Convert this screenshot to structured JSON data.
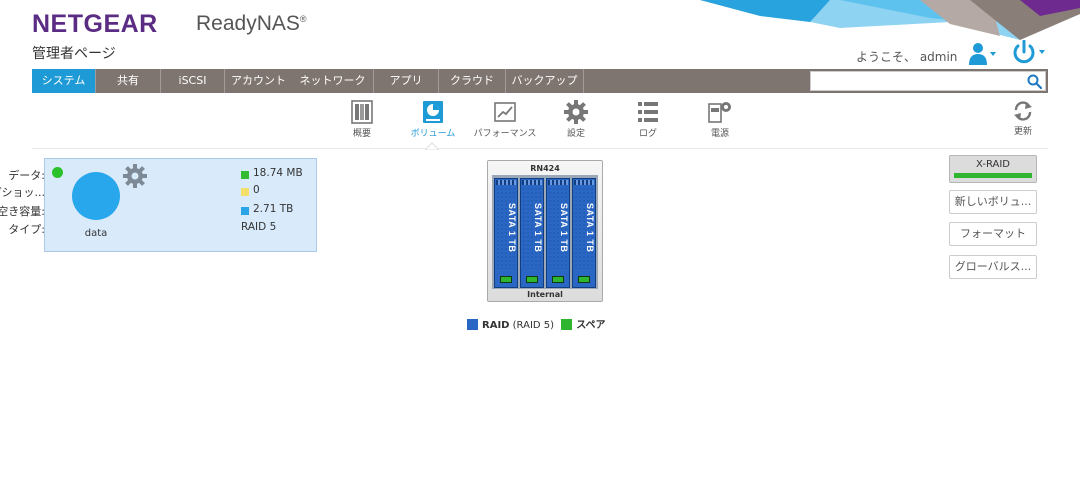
{
  "header": {
    "brand": "NETGEAR",
    "product": "ReadyNAS",
    "page_title": "管理者ページ",
    "welcome": "ようこそ、 admin"
  },
  "nav": {
    "tabs": [
      {
        "label": "システム",
        "active": true
      },
      {
        "label": "共有",
        "active": false
      },
      {
        "label": "iSCSI",
        "active": false
      },
      {
        "label": "アカウント",
        "active": false
      },
      {
        "label": "ネットワーク",
        "active": false
      },
      {
        "label": "アプリ",
        "active": false
      },
      {
        "label": "クラウド",
        "active": false
      },
      {
        "label": "バックアップ",
        "active": false
      }
    ],
    "search_value": ""
  },
  "subnav": {
    "items": [
      {
        "label": "概要",
        "icon": "overview-icon"
      },
      {
        "label": "ボリューム",
        "icon": "volume-icon",
        "active": true
      },
      {
        "label": "パフォーマンス",
        "icon": "performance-icon"
      },
      {
        "label": "設定",
        "icon": "settings-gear-icon"
      },
      {
        "label": "ログ",
        "icon": "logs-icon"
      },
      {
        "label": "電源",
        "icon": "power-settings-icon"
      }
    ],
    "refresh_label": "更新"
  },
  "volume": {
    "name": "data",
    "status_color": "#2bc12b",
    "rows": [
      {
        "key": "データ:",
        "value": "18.74 MB",
        "color": "#33bb33"
      },
      {
        "key": "スナップショッ...",
        "value": "0",
        "color": "#f2e06a"
      },
      {
        "key": "空き容量:",
        "value": "2.71 TB",
        "color": "#2aa4e6"
      },
      {
        "key": "タイプ:",
        "value": "RAID 5",
        "color": ""
      }
    ]
  },
  "nas": {
    "model": "RN424",
    "location": "Internal",
    "disks": [
      "SATA 1 TB",
      "SATA 1 TB",
      "SATA 1 TB",
      "SATA 1 TB"
    ]
  },
  "legend": {
    "raid_label": "RAID",
    "raid_type": "(RAID 5)",
    "spare_label": "スペア",
    "raid_color": "#2a67c4",
    "spare_color": "#2fb52f"
  },
  "actions": {
    "xraid": "X-RAID",
    "new_volume": "新しいボリュ...",
    "format": "フォーマット",
    "global": "グローバルス..."
  }
}
